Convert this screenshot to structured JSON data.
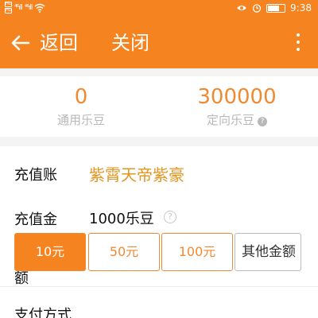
{
  "status_bar": {
    "sim1": "HD",
    "sim2": "HD",
    "signal1": "⁴⁶ıll",
    "signal2": "⁴⁶ıll",
    "time": "9:38"
  },
  "app_bar": {
    "back_label": "返回",
    "close_label": "关闭"
  },
  "balance": {
    "general_value": "0",
    "general_label": "通用乐豆",
    "directed_value": "300000",
    "directed_label": "定向乐豆"
  },
  "form": {
    "account_label": "充值账",
    "account_value": "紫霄天帝紫豪",
    "amount_label_line1": "充值金",
    "amount_label_line2": "额",
    "amount_value": "1000乐豆",
    "options": [
      "10元",
      "50元",
      "100元",
      "其他金额"
    ],
    "payment_label": "支付方式"
  },
  "colors": {
    "brand_orange": "#f5831f",
    "accent_gold": "#e59520"
  }
}
